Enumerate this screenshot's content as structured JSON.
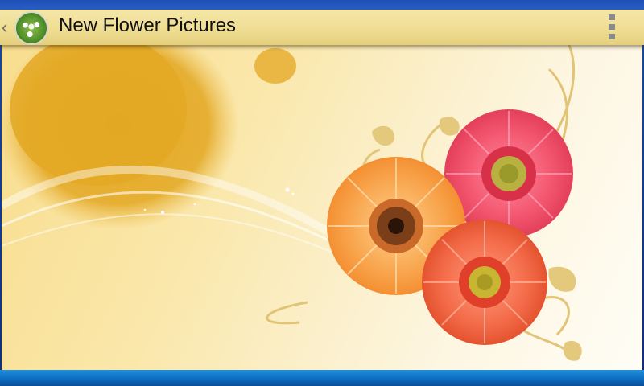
{
  "app_bar": {
    "title": "New Flower Pictures",
    "up_icon": "chevron-left-icon",
    "app_icon": "flower-app-icon",
    "overflow_icon": "more-vertical-icon"
  },
  "wallpaper": {
    "description_icon": "flower-wallpaper-image",
    "colors": {
      "background": "#f9e4a2",
      "blot": "#e6ae2c",
      "orange_flower": "#f7a14a",
      "pink_flower": "#f0566e",
      "coral_flower": "#f06a4a",
      "swirl": "#e3c77a"
    }
  }
}
